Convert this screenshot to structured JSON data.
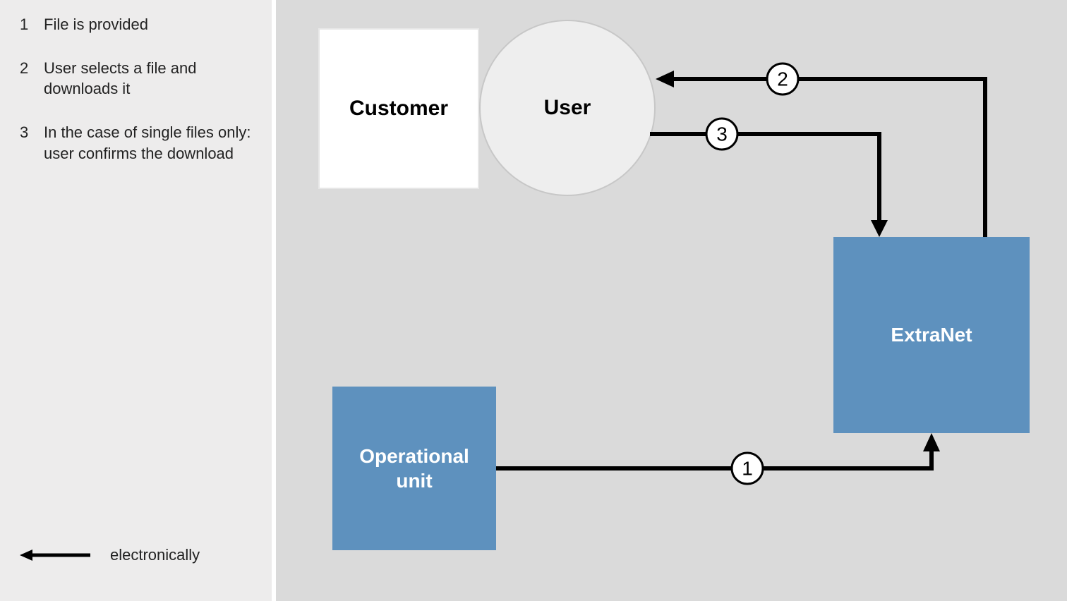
{
  "legend": {
    "steps": [
      {
        "num": "1",
        "text": "File is provided"
      },
      {
        "num": "2",
        "text": "User selects a file and downloads it"
      },
      {
        "num": "3",
        "text": "In the case of single files only:\nuser confirms the download"
      }
    ],
    "arrow_label": "electronically"
  },
  "diagram": {
    "nodes": {
      "customer": "Customer",
      "user": "User",
      "operational_unit": "Operational\nunit",
      "extranet": "ExtraNet"
    },
    "edge_labels": {
      "e1": "1",
      "e2": "2",
      "e3": "3"
    },
    "edges_description": [
      {
        "id": "e1",
        "from": "operational_unit",
        "to": "extranet"
      },
      {
        "id": "e2",
        "from": "extranet",
        "to": "user"
      },
      {
        "id": "e3",
        "from": "user",
        "to": "extranet"
      }
    ]
  }
}
